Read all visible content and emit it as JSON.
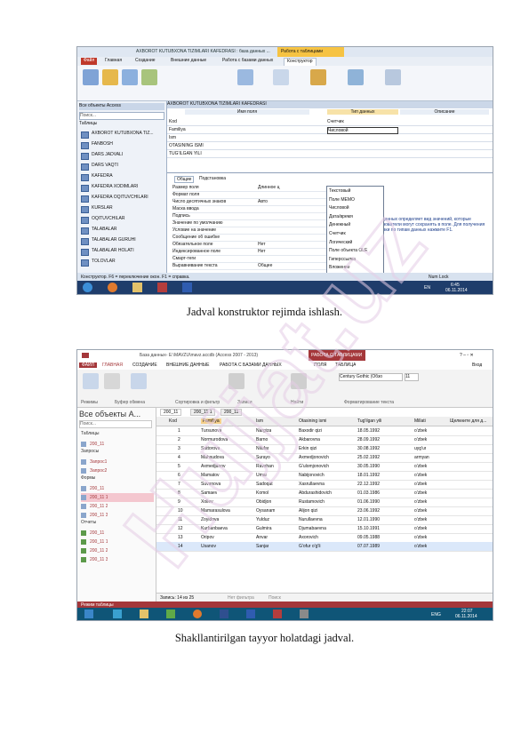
{
  "captions": {
    "figure1": "Jadval konstruktor rejimda ishlash.",
    "figure2": "Shakllantirilgan tayyor holatdagi jadval."
  },
  "watermark": {
    "text": "Hujjat.uz",
    "color": "#e5cde6"
  },
  "shot1": {
    "title": "AXBOROT KUTUBXONA TIZIMLARI KAFEDRASI : база данных ...",
    "context_tab": "Работа с таблицами",
    "tabs": [
      "Файл",
      "Главная",
      "Создание",
      "Внешние данные",
      "Работа с базами данных",
      "Конструктор"
    ],
    "nav_header": "Все объекты Access",
    "nav_search": "Поиск...",
    "nav_group": "Таблицы",
    "nav_items": [
      "AXBOROT KUTUBXONA TIZ...",
      "FANBOSH",
      "DARS JADVALI",
      "DARS VAQTI",
      "KAFEDRA",
      "KAFEDRA XODIMLARI",
      "KAFEDRA OQITUVCHILARI",
      "KURSLAR",
      "OQITUVCHILAR",
      "TALABALAR",
      "TALABALAR GURUHI",
      "TALABALAR HOLATI",
      "TOLOVLAR"
    ],
    "doc_tab": "AXBOROT KUTUBXONA TIZIMLARI KAFEDRASI",
    "col_headers": [
      "Имя поля",
      "Тип данных",
      "Описание"
    ],
    "fields": [
      {
        "name": "Kod",
        "type": "Счетчик"
      },
      {
        "name": "Familiya",
        "type": "Числовой"
      },
      {
        "name": "Ism",
        "type": ""
      },
      {
        "name": "OTASINING ISMI",
        "type": ""
      },
      {
        "name": "TUG'ILGAN YILI",
        "type": ""
      }
    ],
    "dropdown": [
      "Текстовый",
      "Поле MEMO",
      "Числовой",
      "Дата/время",
      "Денежный",
      "Счетчик",
      "Логический",
      "Поле объекта OLE",
      "Гиперссылка",
      "Вложение",
      "Вычисляемый",
      "Мастер подстановок..."
    ],
    "prop_tabs": [
      "Общие",
      "Подстановка"
    ],
    "props": [
      "Размер поля",
      "Формат поля",
      "Число десятичных знаков",
      "Маска ввода",
      "Подпись",
      "Значение по умолчанию",
      "Условие на значение",
      "Сообщение об ошибке",
      "Обязательное поле",
      "Индексированное поле",
      "Смарт-теги",
      "Выравнивание текста"
    ],
    "prop_values": [
      "Длинное ц",
      "",
      "Авто",
      "",
      "",
      "",
      "",
      "",
      "Нет",
      "Нет",
      "",
      "Общее"
    ],
    "hint": "Тип данных определяет вид значений, которые пользователи могут сохранять в поле. Для получения справки по типам данных нажмите F1.",
    "status": "Конструктор. F6 = переключение окон. F1 = справка.",
    "status_right": "Num Lock",
    "time": "6:45",
    "date": "06.11.2014",
    "lang": "EN"
  },
  "shot2": {
    "title": "База данных- E:\\MAVZU\\mavz.accdb (Access 2007 - 2013)",
    "context_tab": "РАБОТА С ТАБЛИЦАМИ",
    "tabs": [
      "ФАЙЛ",
      "ГЛАВНАЯ",
      "СОЗДАНИЕ",
      "ВНЕШНИЕ ДАННЫЕ",
      "РАБОТА С БАЗАМИ ДАННЫХ",
      "ПОЛЯ",
      "ТАБЛИЦА"
    ],
    "signin": "Вход",
    "font_box": "Century Gothic (Обзо",
    "font_size": "11",
    "groups": [
      "Режимы",
      "Буфер обмена",
      "Сортировка и фильтр",
      "Записи",
      "Найти",
      "Форматирование текста"
    ],
    "nav_header": "Все объекты A...",
    "nav_search": "Поиск...",
    "nav_sections": [
      {
        "name": "Таблицы",
        "items": [
          "200_11"
        ]
      },
      {
        "name": "Запросы",
        "items": [
          "Запрос1",
          "Запрос2"
        ]
      },
      {
        "name": "Формы",
        "items": [
          "200_11",
          "200_11 1",
          "200_11 2",
          "200_11 3"
        ]
      },
      {
        "name": "Отчеты",
        "items": [
          "200_11",
          "200_11 1",
          "200_11 2",
          "200_11 3"
        ]
      }
    ],
    "doc_tabs": [
      "200_11",
      "200_11 1",
      "200_11"
    ],
    "columns": [
      "Kod",
      "Familiya",
      "Ism",
      "Otasining ismi",
      "Tug'ilgan yili",
      "Millati",
      "Щелкните для д..."
    ],
    "rows": [
      [
        "1",
        "Tursunova",
        "Nargiza",
        "Baxodir qizi",
        "18.05.1992",
        "o'zbek"
      ],
      [
        "2",
        "Normurodova",
        "Barno",
        "Akbarovna",
        "28.09.1992",
        "o'zbek"
      ],
      [
        "3",
        "Sattorova",
        "Nilufar",
        "Erkin qizi",
        "30.08.1992",
        "uyg'ur"
      ],
      [
        "4",
        "Mahsudova",
        "Surayo",
        "Axmedjonovich",
        "25.02.1992",
        "armyan"
      ],
      [
        "5",
        "Axmedjanov",
        "Ravshan",
        "G'ulomjonovich",
        "30.05.1990",
        "o'zbek"
      ],
      [
        "6",
        "Mamatov",
        "Umar",
        "Nabijonovich",
        "18.01.1992",
        "o'zbek"
      ],
      [
        "7",
        "Suvanova",
        "Sadoqat",
        "Xasrullaevna",
        "22.12.1992",
        "o'zbek"
      ],
      [
        "8",
        "Samaev",
        "Komol",
        "Abdurashidovich",
        "01.03.1986",
        "o'zbek"
      ],
      [
        "9",
        "Xoliev",
        "Obidjon",
        "Rustamovich",
        "01.06.1990",
        "o'zbek"
      ],
      [
        "10",
        "Mamarasulova",
        "Oysanam",
        "Alijon qizi",
        "23.06.1992",
        "o'zbek"
      ],
      [
        "11",
        "Zoyidova",
        "Yulduz",
        "Nurullaevna",
        "12.01.1990",
        "o'zbek"
      ],
      [
        "12",
        "Kurbanbaeva",
        "Gulmira",
        "Djumabaevna",
        "15.10.1991",
        "o'zbek"
      ],
      [
        "13",
        "Oripov",
        "Anvar",
        "Axorovich",
        "09.05.1988",
        "o'zbek"
      ],
      [
        "14",
        "Usanov",
        "Sanjar",
        "G'ofur o'g'li",
        "07.07.1989",
        "o'zbek"
      ]
    ],
    "record_nav": "Запись: 14 из 25",
    "filter_label": "Нет фильтра",
    "search_label": "Поиск",
    "status": "Режим таблицы",
    "time": "22:07",
    "date": "06.11.2014",
    "lang": "ENG"
  }
}
